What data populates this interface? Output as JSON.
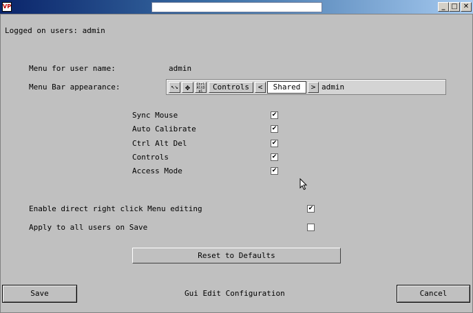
{
  "window": {
    "app_icon": "VP",
    "minimize_icon": "_",
    "maximize_icon": "□",
    "close_icon": "✕"
  },
  "header": {
    "logged_on": "Logged on users: admin"
  },
  "form": {
    "menu_for_user_label": "Menu for user name:",
    "menu_for_user_value": "admin",
    "menu_bar_label": "Menu Bar appearance:",
    "menu_bar": {
      "icon1": "↖↘",
      "icon2": "✥",
      "icon3": "CtrlAltDel",
      "controls_label": "Controls",
      "prev_label": "<",
      "mode_value": "Shared",
      "next_label": ">",
      "user_label": "admin"
    },
    "options": [
      {
        "label": "Sync Mouse",
        "checked": true
      },
      {
        "label": "Auto Calibrate",
        "checked": true
      },
      {
        "label": "Ctrl Alt Del",
        "checked": true
      },
      {
        "label": "Controls",
        "checked": true
      },
      {
        "label": "Access Mode",
        "checked": true
      }
    ],
    "enable_direct_label": "Enable direct right click Menu editing",
    "enable_direct_checked": true,
    "apply_all_label": "Apply to all users on Save",
    "apply_all_checked": false,
    "reset_button": "Reset to Defaults"
  },
  "footer": {
    "save_button": "Save",
    "title": "Gui Edit Configuration",
    "cancel_button": "Cancel"
  },
  "check_mark": "✔"
}
